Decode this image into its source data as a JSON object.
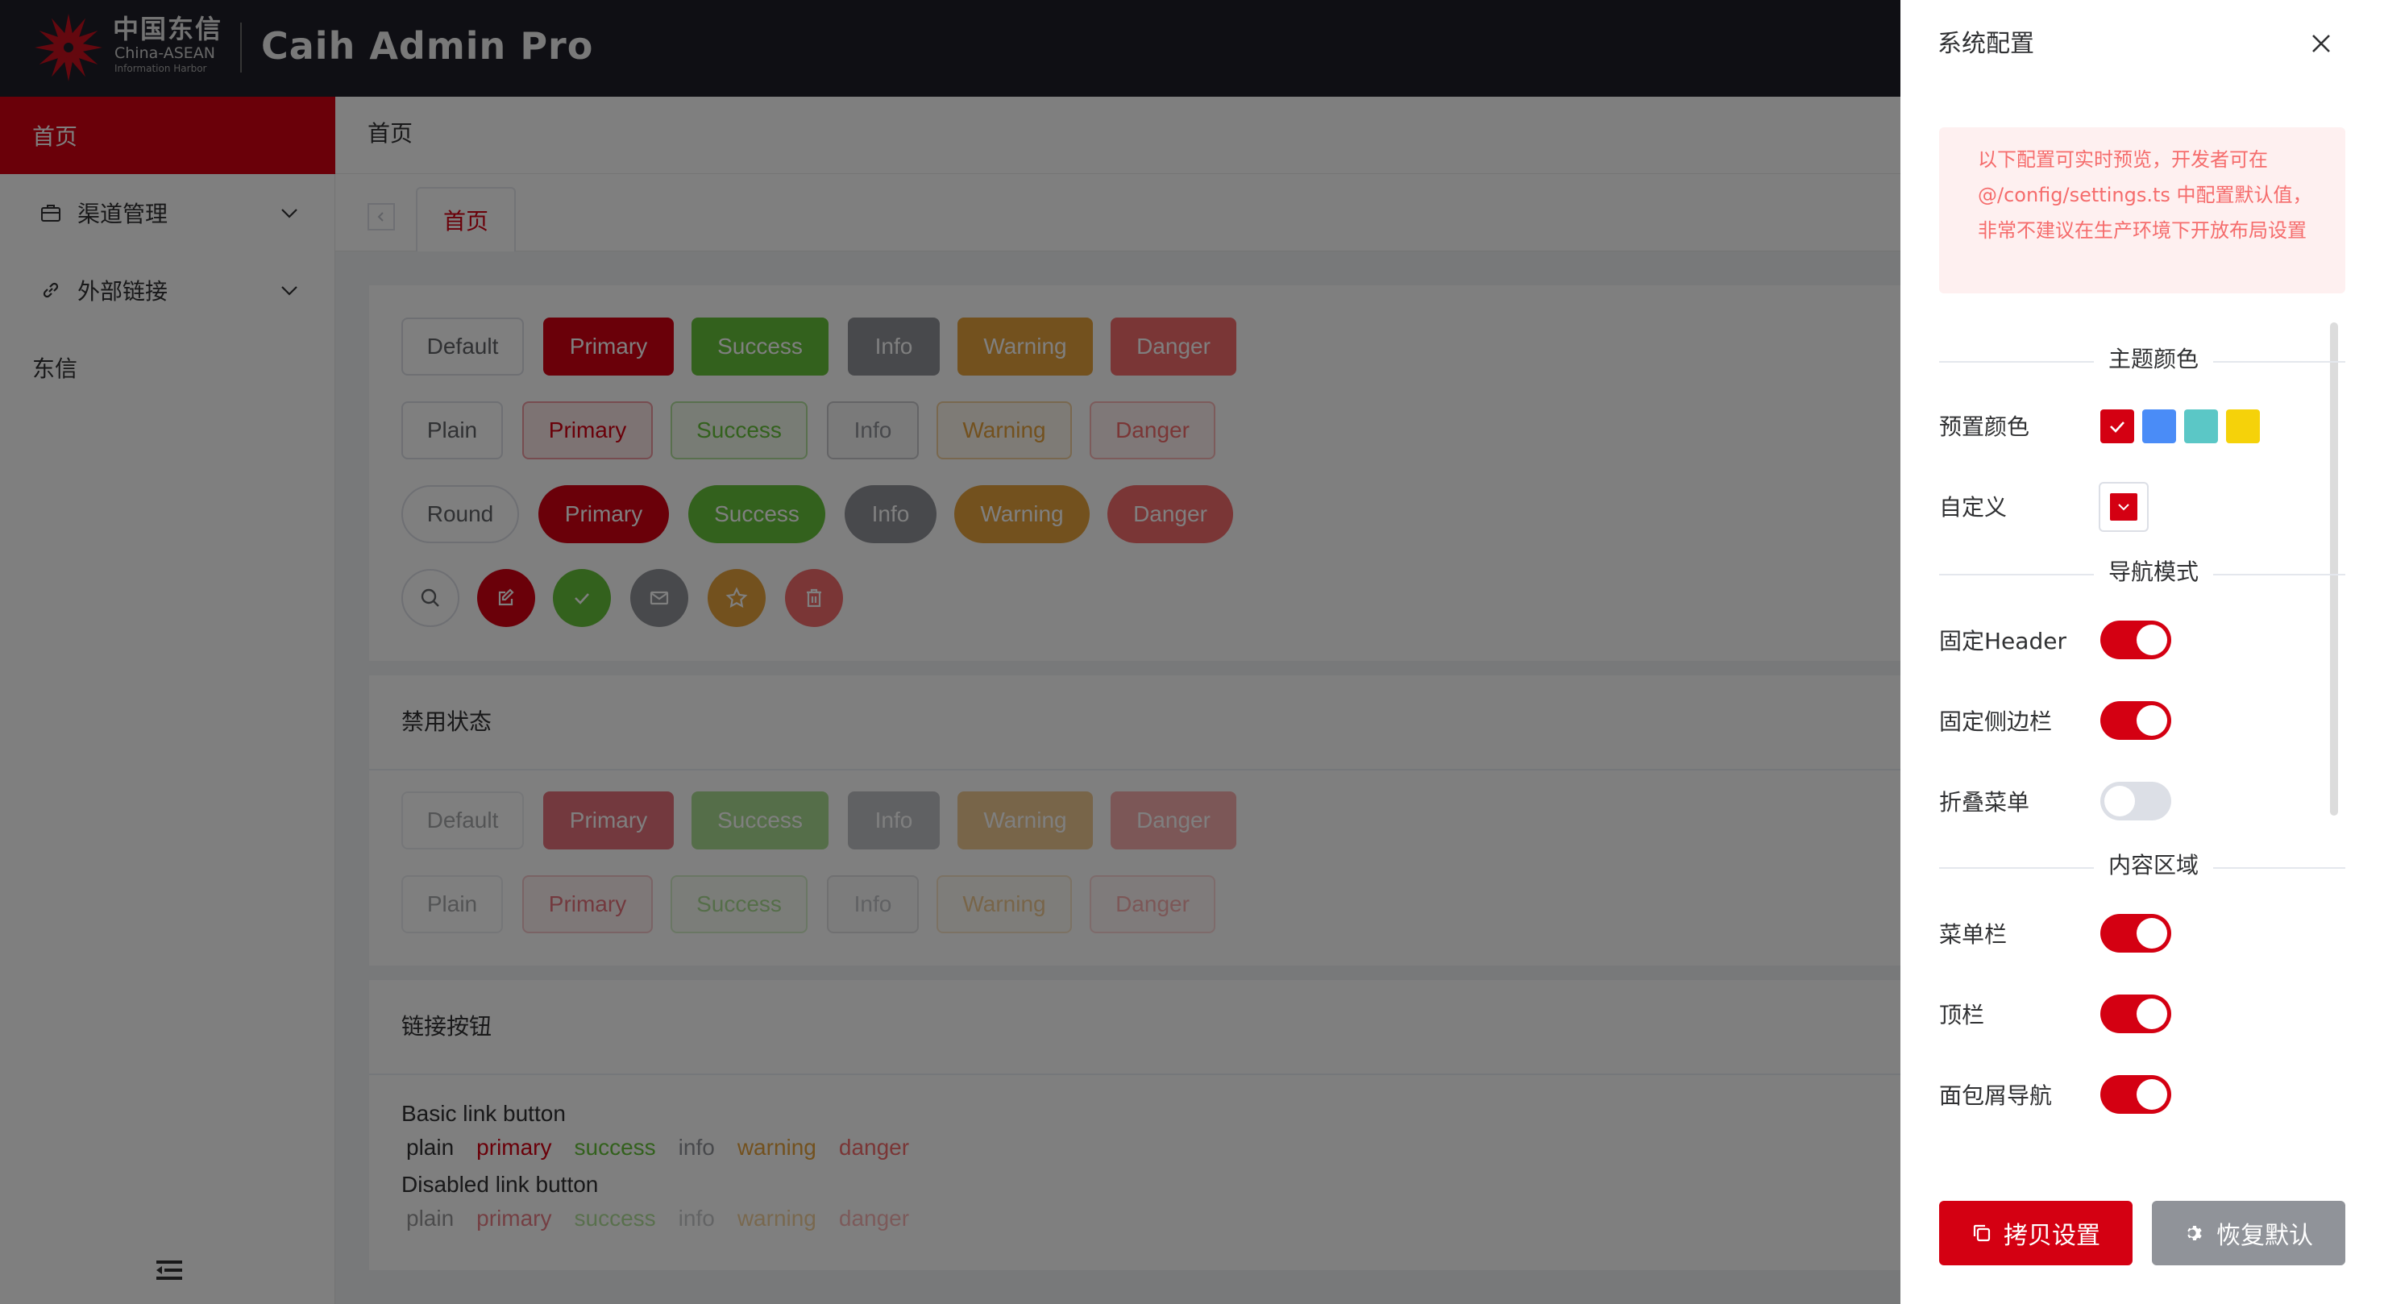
{
  "header": {
    "logo_cn": "中国东信",
    "logo_en_line1": "China-ASEAN",
    "logo_en_line2": "Information Harbor",
    "app_title": "Caih Admin Pro"
  },
  "sidebar": {
    "items": [
      {
        "label": "首页",
        "icon": "none"
      },
      {
        "label": "渠道管理",
        "icon": "briefcase-icon"
      },
      {
        "label": "外部链接",
        "icon": "link-icon"
      },
      {
        "label": "东信",
        "icon": "none"
      }
    ]
  },
  "topbar": {
    "breadcrumb": "首页"
  },
  "tabs": {
    "home": "首页"
  },
  "buttons": {
    "row1": [
      "Default",
      "Primary",
      "Success",
      "Info",
      "Warning",
      "Danger"
    ],
    "row2": [
      "Plain",
      "Primary",
      "Success",
      "Info",
      "Warning",
      "Danger"
    ],
    "row3": [
      "Round",
      "Primary",
      "Success",
      "Info",
      "Warning",
      "Danger"
    ],
    "icons": [
      "search-icon",
      "edit-icon",
      "check-icon",
      "message-icon",
      "star-icon",
      "delete-icon"
    ]
  },
  "disabled_card": {
    "title": "禁用状态",
    "row1": [
      "Default",
      "Primary",
      "Success",
      "Info",
      "Warning",
      "Danger"
    ],
    "row2": [
      "Plain",
      "Primary",
      "Success",
      "Info",
      "Warning",
      "Danger"
    ]
  },
  "link_card": {
    "title": "链接按钮",
    "basic_label": "Basic link button",
    "disabled_label": "Disabled link button",
    "links": [
      "plain",
      "primary",
      "success",
      "info",
      "warning",
      "danger"
    ]
  },
  "drawer": {
    "title": "系统配置",
    "alert": "以下配置可实时预览，开发者可在 @/config/settings.ts 中配置默认值，非常不建议在生产环境下开放布局设置",
    "theme_section": "主题颜色",
    "preset_colors_label": "预置颜色",
    "preset_colors": [
      "#d40012",
      "#4a8cf7",
      "#5bc7c6",
      "#f5d20a"
    ],
    "custom_label": "自定义",
    "nav_section": "导航模式",
    "fixed_header_label": "固定Header",
    "fixed_header": true,
    "fixed_sidebar_label": "固定侧边栏",
    "fixed_sidebar": true,
    "collapse_menu_label": "折叠菜单",
    "collapse_menu": false,
    "content_section": "内容区域",
    "menubar_label": "菜单栏",
    "menubar": true,
    "topbar_label": "顶栏",
    "topbar": true,
    "breadcrumb_label": "面包屑导航",
    "breadcrumb": true,
    "copy_button": "拷贝设置",
    "reset_button": "恢复默认"
  },
  "colors": {
    "primary": "#d40012",
    "success": "#67c23a",
    "info": "#909399",
    "warning": "#e6a23c",
    "danger": "#f56c6c",
    "header_bg": "#1e1e28"
  }
}
